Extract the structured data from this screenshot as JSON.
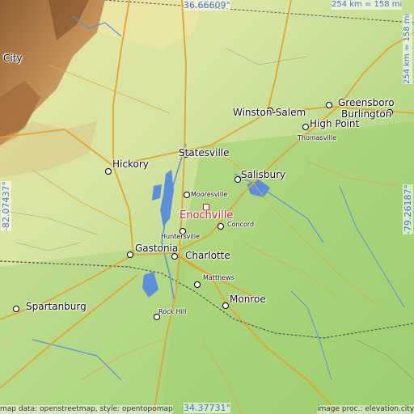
{
  "map": {
    "highlight": {
      "name": "Enochville",
      "color": "#d11f2e"
    },
    "cities": [
      {
        "id": "city",
        "name": "City"
      },
      {
        "id": "winston-salem",
        "name": "Winston-Salem"
      },
      {
        "id": "greensboro",
        "name": "Greensboro"
      },
      {
        "id": "burlington",
        "name": "Burlington"
      },
      {
        "id": "high-point",
        "name": "High Point"
      },
      {
        "id": "thomasville",
        "name": "Thomasville"
      },
      {
        "id": "statesville",
        "name": "Statesville"
      },
      {
        "id": "hickory",
        "name": "Hickory"
      },
      {
        "id": "salisbury",
        "name": "Salisbury"
      },
      {
        "id": "mooresville",
        "name": "Mooresville"
      },
      {
        "id": "concord",
        "name": "Concord"
      },
      {
        "id": "huntersville",
        "name": "Huntersville"
      },
      {
        "id": "gastonia",
        "name": "Gastonia"
      },
      {
        "id": "charlotte",
        "name": "Charlotte"
      },
      {
        "id": "matthews",
        "name": "Matthews"
      },
      {
        "id": "monroe",
        "name": "Monroe"
      },
      {
        "id": "spartanburg",
        "name": "Spartanburg"
      },
      {
        "id": "rock-hill",
        "name": "Rock Hill"
      }
    ],
    "coordinates": {
      "north": "36.66609°",
      "south": "34.37731°",
      "west": "-82.07437°",
      "east": "-79.26187°"
    },
    "scale": {
      "horizontal": "254 km = 158 mi",
      "vertical": "254 km = 158 mi"
    },
    "credits": {
      "left": "map data: openstreetmap, style: opentopomap",
      "right": "image proc.: elevation.city"
    },
    "colors": {
      "lowland": "#a9d279",
      "upland": "#e6e2a0",
      "mountain": "#b57a46",
      "water": "#5b8fdc",
      "roads": "#e0a532"
    }
  }
}
